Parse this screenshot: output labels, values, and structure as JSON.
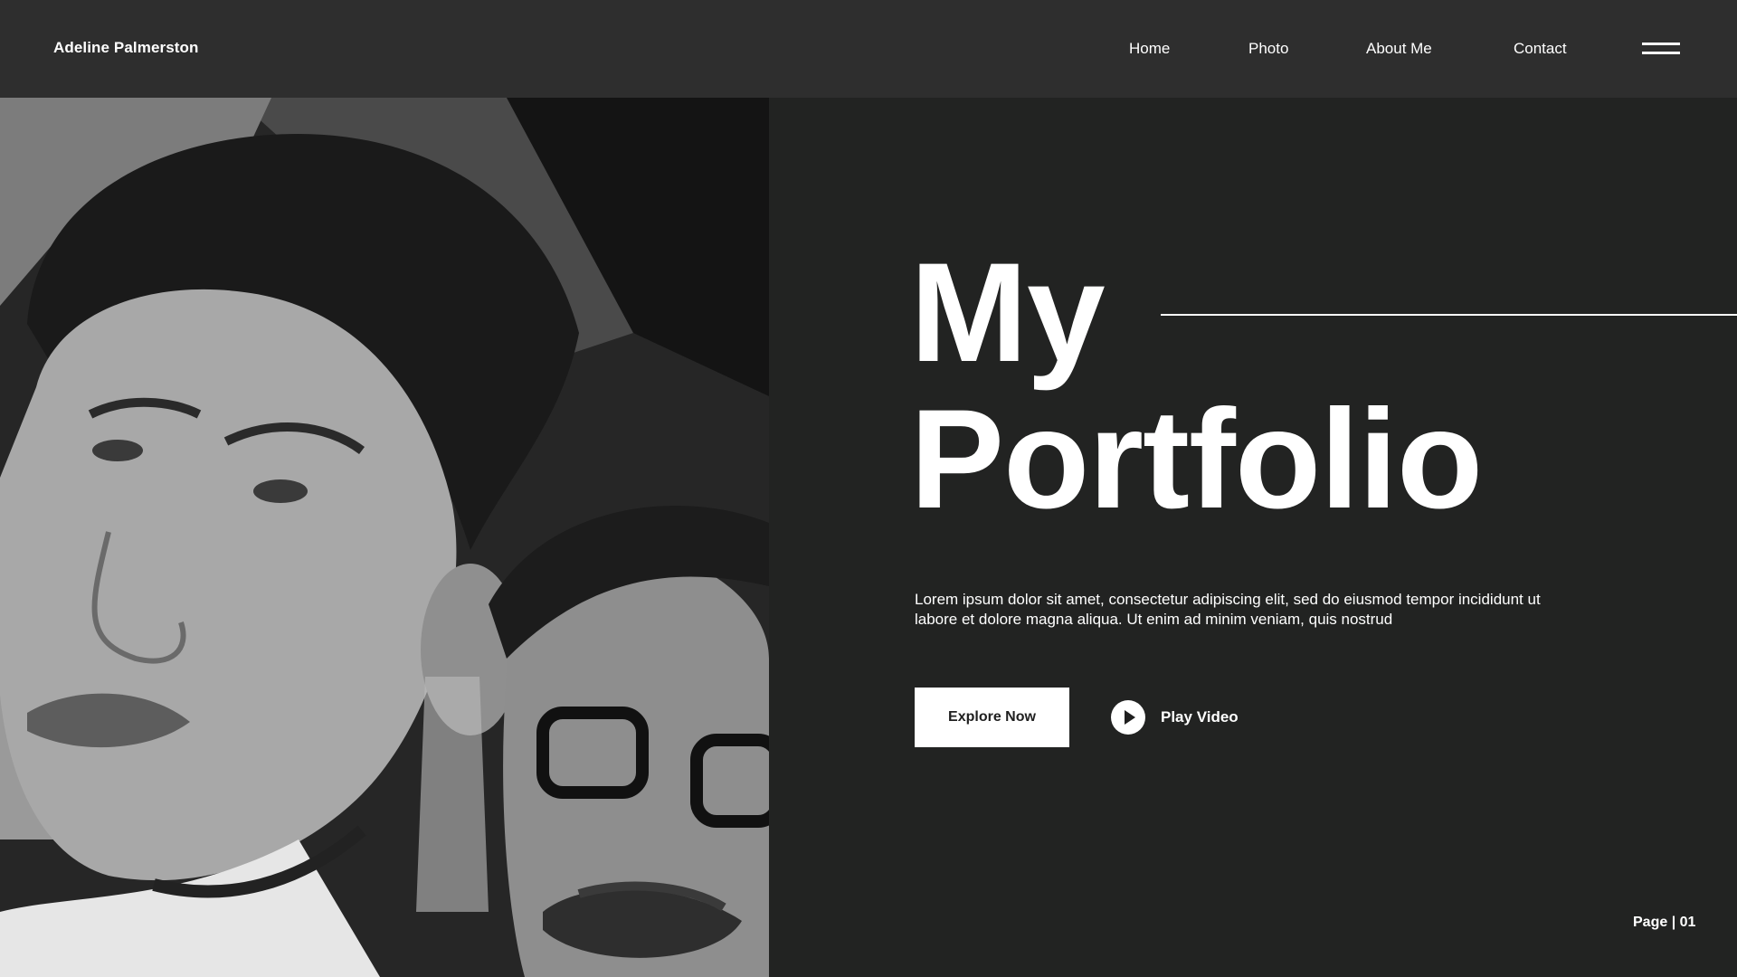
{
  "header": {
    "brand": "Adeline Palmerston",
    "nav": [
      {
        "label": "Home"
      },
      {
        "label": "Photo"
      },
      {
        "label": "About Me"
      },
      {
        "label": "Contact"
      }
    ],
    "menu_icon": "hamburger-icon"
  },
  "photo": {
    "style": "grayscale",
    "alt": "portrait-photo"
  },
  "hero": {
    "title_line1": "My",
    "title_line2": "Portfolio",
    "description": "Lorem ipsum dolor sit amet, consectetur adipiscing elit, sed do eiusmod tempor incididunt ut labore et dolore magna aliqua. Ut enim ad minim veniam, quis nostrud",
    "primary_button": "Explore Now",
    "secondary_button": "Play Video",
    "play_icon": "play-icon"
  },
  "footer": {
    "page_indicator": "Page | 01"
  },
  "colors": {
    "background": "#222322",
    "header": "#2e2e2e",
    "text": "#ffffff",
    "button_bg": "#ffffff",
    "button_text": "#1f1f1f"
  }
}
